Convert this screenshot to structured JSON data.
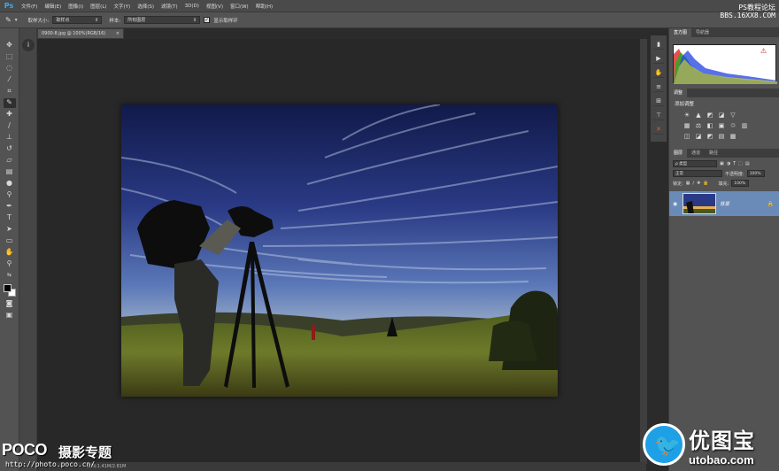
{
  "app": {
    "logo": "Ps",
    "menu": [
      "文件(F)",
      "编辑(E)",
      "图像(I)",
      "图层(L)",
      "文字(Y)",
      "选择(S)",
      "滤镜(T)",
      "3D(D)",
      "视图(V)",
      "窗口(W)",
      "帮助(H)"
    ],
    "window_controls": [
      "—",
      "▢",
      "✕"
    ]
  },
  "watermark_top": {
    "line1": "PS教程论坛",
    "line2": "BBS.16XX8.COM"
  },
  "options": {
    "sample_size_label": "取样大小:",
    "sample_size_value": "取样点",
    "sample_label": "样本:",
    "sample_value": "所有图层",
    "show_ring_label": "显示取样环"
  },
  "document": {
    "tab_title": "0900-8.jpg @ 100%(RGB/16)",
    "tab_close": "×",
    "status": "文档:1.41M/2.81M"
  },
  "panels": {
    "histogram_tabs": [
      "直方图",
      "导航器"
    ],
    "adjustments_tab": "调整",
    "adjustments_title": "添加调整",
    "layers_tabs": [
      "图层",
      "通道",
      "路径"
    ],
    "filter_kind": "ρ 类型",
    "blend_mode": "正常",
    "opacity_label": "不透明度:",
    "opacity_value": "100%",
    "lock_label": "锁定:",
    "fill_label": "填充:",
    "fill_value": "100%",
    "layer_name": "背景"
  },
  "watermarks": {
    "poco": "POCO",
    "poco_sub": "摄影专题",
    "poco_url": "http://photo.poco.cn/",
    "utobao_cn": "优图宝",
    "utobao_en": "utobao.com"
  },
  "colors": {
    "accent": "#3fa9f5",
    "layer_selected": "#6a8ab8",
    "utobao_blue": "#1ea0e6"
  }
}
